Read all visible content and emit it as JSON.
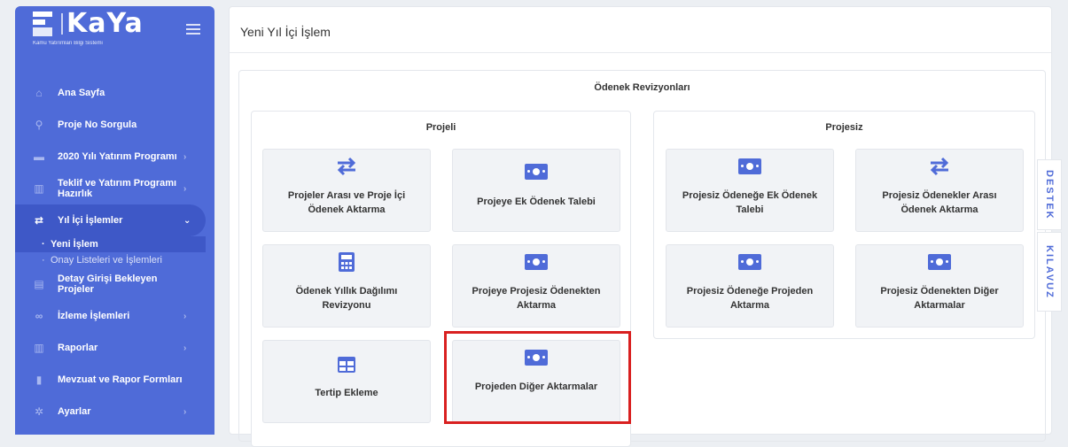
{
  "brand": {
    "title": "KaYa",
    "subtitle": "Kamu Yatırımları Bilgi Sistemi"
  },
  "sidebar": {
    "items": [
      {
        "label": "Ana Sayfa",
        "icon": "home-icon"
      },
      {
        "label": "Proje No Sorgula",
        "icon": "search-icon"
      },
      {
        "label": "2020 Yılı Yatırım Programı",
        "icon": "folder-icon"
      },
      {
        "label": "Teklif ve Yatırım Programı Hazırlık",
        "icon": "chart-icon"
      },
      {
        "label": "Yıl İçi İşlemler",
        "icon": "exchange-icon"
      },
      {
        "label": "Detay Girişi Bekleyen Projeler",
        "icon": "list-icon"
      },
      {
        "label": "İzleme İşlemleri",
        "icon": "binoculars-icon"
      },
      {
        "label": "Raporlar",
        "icon": "report-icon"
      },
      {
        "label": "Mevzuat ve Rapor Formları",
        "icon": "document-icon"
      },
      {
        "label": "Ayarlar",
        "icon": "gear-icon"
      }
    ],
    "subitems": [
      {
        "label": "Yeni İşlem"
      },
      {
        "label": "Onay Listeleri ve İşlemleri"
      }
    ]
  },
  "main": {
    "title": "Yeni Yıl İçi İşlem",
    "section_title": "Ödenek Revizyonları",
    "projeli": {
      "title": "Projeli",
      "tiles": [
        {
          "label": "Projeler Arası ve Proje İçi Ödenek Aktarma",
          "icon": "exchange-icon"
        },
        {
          "label": "Projeye Ek Ödenek Talebi",
          "icon": "money-icon"
        },
        {
          "label": "Ödenek Yıllık Dağılımı Revizyonu",
          "icon": "calculator-icon"
        },
        {
          "label": "Projeye Projesiz Ödenekten Aktarma",
          "icon": "money-icon"
        },
        {
          "label": "Tertip Ekleme",
          "icon": "table-icon"
        },
        {
          "label": "Projeden Diğer Aktarmalar",
          "icon": "money-icon"
        }
      ]
    },
    "projesiz": {
      "title": "Projesiz",
      "tiles": [
        {
          "label": "Projesiz Ödeneğe Ek Ödenek Talebi",
          "icon": "money-icon"
        },
        {
          "label": "Projesiz Ödenekler Arası Ödenek Aktarma",
          "icon": "exchange-icon"
        },
        {
          "label": "Projesiz Ödeneğe Projeden Aktarma",
          "icon": "money-icon"
        },
        {
          "label": "Projesiz Ödenekten Diğer Aktarmalar",
          "icon": "money-icon"
        }
      ]
    }
  },
  "side_tabs": {
    "destek": "DESTEK",
    "kilavuz": "KILAVUZ"
  },
  "colors": {
    "primary": "#4f6bd8",
    "highlight": "#d92020"
  }
}
